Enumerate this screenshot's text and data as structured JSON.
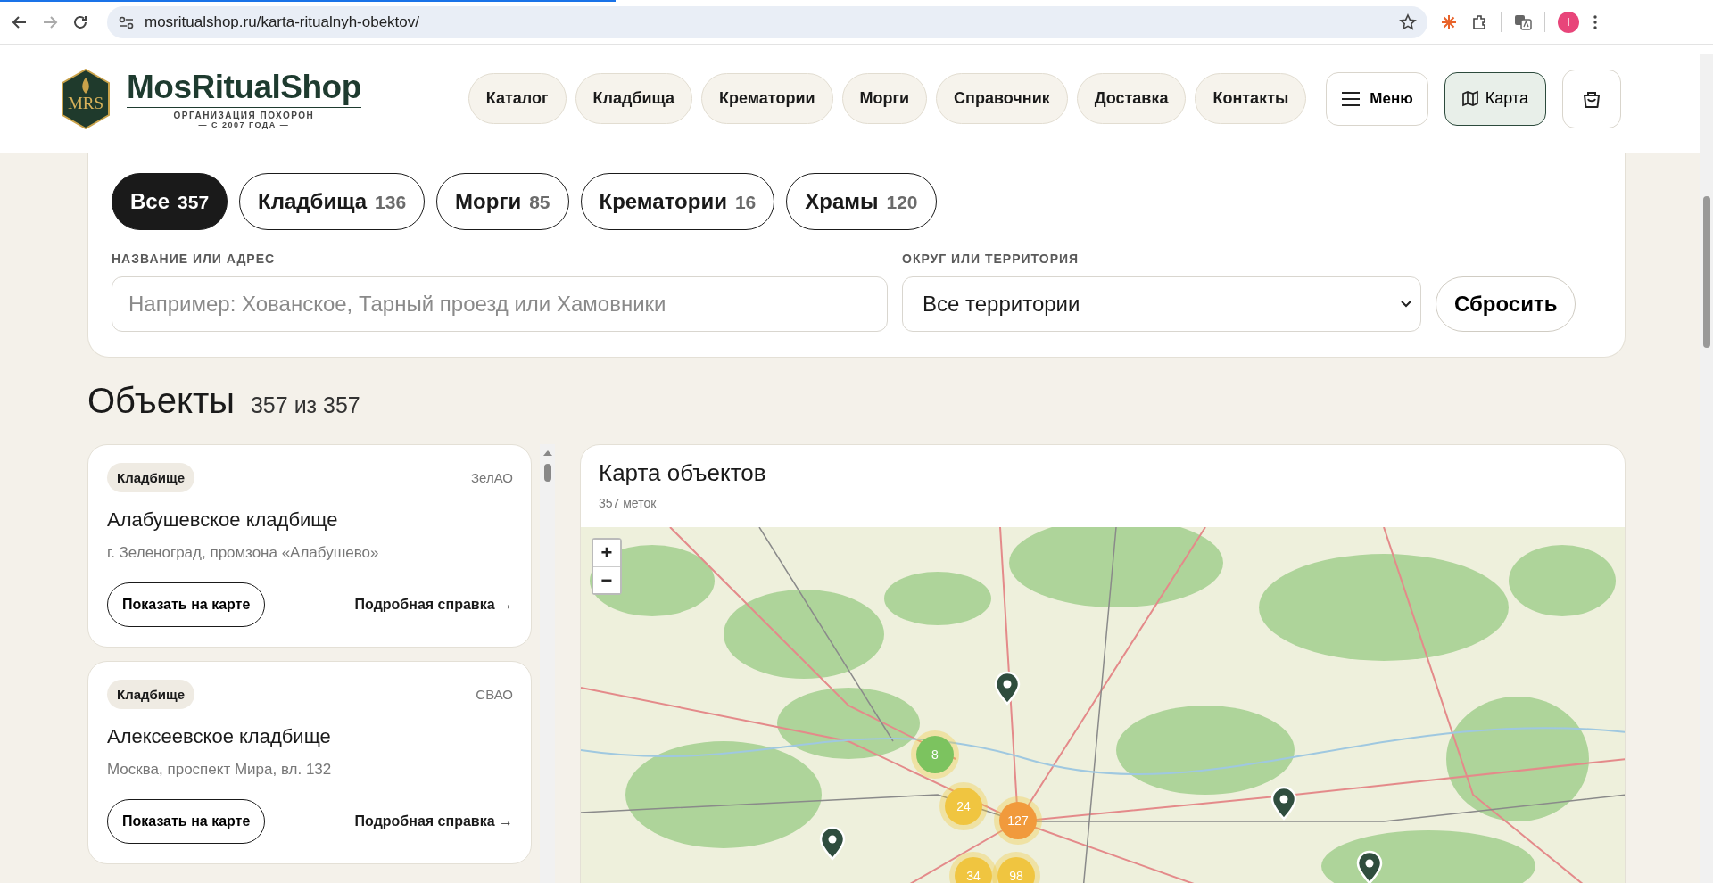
{
  "browser": {
    "url": "mosritualshop.ru/karta-ritualnyh-obektov/",
    "profile_initial": "I"
  },
  "header": {
    "logo": {
      "monogram": "MRS",
      "name": "MosRitualShop",
      "tagline": "ОРГАНИЗАЦИЯ ПОХОРОН",
      "since": "— С 2007 ГОДА —"
    },
    "nav": [
      "Каталог",
      "Кладбища",
      "Крематории",
      "Морги",
      "Справочник",
      "Доставка",
      "Контакты"
    ],
    "menu_button": "Меню",
    "map_button": {
      "label": "Карта",
      "active": true
    }
  },
  "filters": {
    "tabs": [
      {
        "label": "Все",
        "count": "357",
        "selected": true
      },
      {
        "label": "Кладбища",
        "count": "136",
        "selected": false
      },
      {
        "label": "Морги",
        "count": "85",
        "selected": false
      },
      {
        "label": "Крематории",
        "count": "16",
        "selected": false
      },
      {
        "label": "Храмы",
        "count": "120",
        "selected": false
      }
    ],
    "search": {
      "label": "НАЗВАНИЕ ИЛИ АДРЕС",
      "placeholder": "Например: Хованское, Тарный проезд или Хамовники"
    },
    "district": {
      "label": "ОКРУГ ИЛИ ТЕРРИТОРИЯ",
      "value": "Все территории"
    },
    "reset_button": "Сбросить"
  },
  "objects": {
    "title": "Объекты",
    "count": "357 из 357",
    "cards": [
      {
        "tag": "Кладбище",
        "district": "ЗелАО",
        "name": "Алабушевское кладбище",
        "address": "г. Зеленоград, промзона «Алабушево»",
        "show_button": "Показать на карте",
        "details_link": "Подробная справка →"
      },
      {
        "tag": "Кладбище",
        "district": "СВАО",
        "name": "Алексеевское кладбище",
        "address": "Москва, проспект Мира, вл. 132",
        "show_button": "Показать на карте",
        "details_link": "Подробная справка →"
      }
    ]
  },
  "map": {
    "title": "Карта объектов",
    "subtitle": "357 меток",
    "zoom_in": "+",
    "zoom_out": "−",
    "clusters": [
      {
        "label": "8",
        "color": "#7cc35f"
      },
      {
        "label": "24",
        "color": "#f0c540"
      },
      {
        "label": "127",
        "color": "#f19a3c"
      },
      {
        "label": "34",
        "color": "#f0c540"
      },
      {
        "label": "98",
        "color": "#f0c540"
      }
    ]
  }
}
